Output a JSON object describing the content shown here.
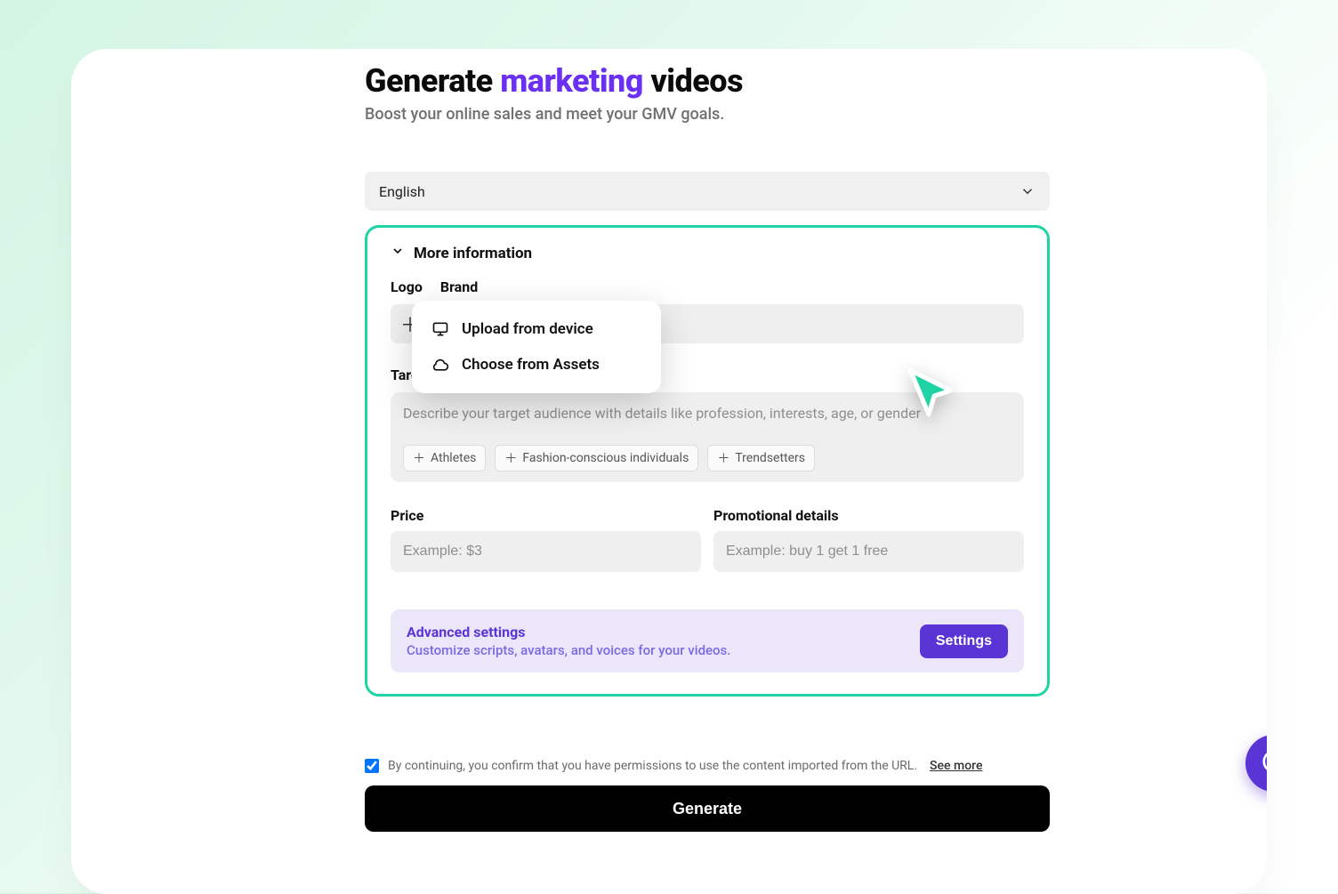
{
  "title": {
    "pre": "Generate ",
    "accent": "marketing",
    "post": " videos"
  },
  "subtitle": "Boost your online sales and meet your GMV goals.",
  "language": {
    "selected": "English"
  },
  "panel": {
    "header": "More information",
    "labels": {
      "logo": "Logo",
      "brand": "Brand"
    },
    "popup": {
      "upload": "Upload from device",
      "assets": "Choose from Assets"
    },
    "audience": {
      "label_visible": "Target a",
      "placeholder": "Describe your target audience with details like profession, interests, age, or gender",
      "chips": [
        "Athletes",
        "Fashion-conscious individuals",
        "Trendsetters"
      ]
    },
    "price": {
      "label": "Price",
      "placeholder": "Example: $3"
    },
    "promo": {
      "label": "Promotional details",
      "placeholder": "Example: buy 1 get 1 free"
    },
    "advanced": {
      "title": "Advanced settings",
      "sub": "Customize scripts, avatars, and voices for your videos.",
      "button": "Settings"
    }
  },
  "consent": {
    "checked": true,
    "text": "By continuing, you confirm that you have permissions to use the content imported from the URL.",
    "see_more": "See more"
  },
  "generate": "Generate"
}
